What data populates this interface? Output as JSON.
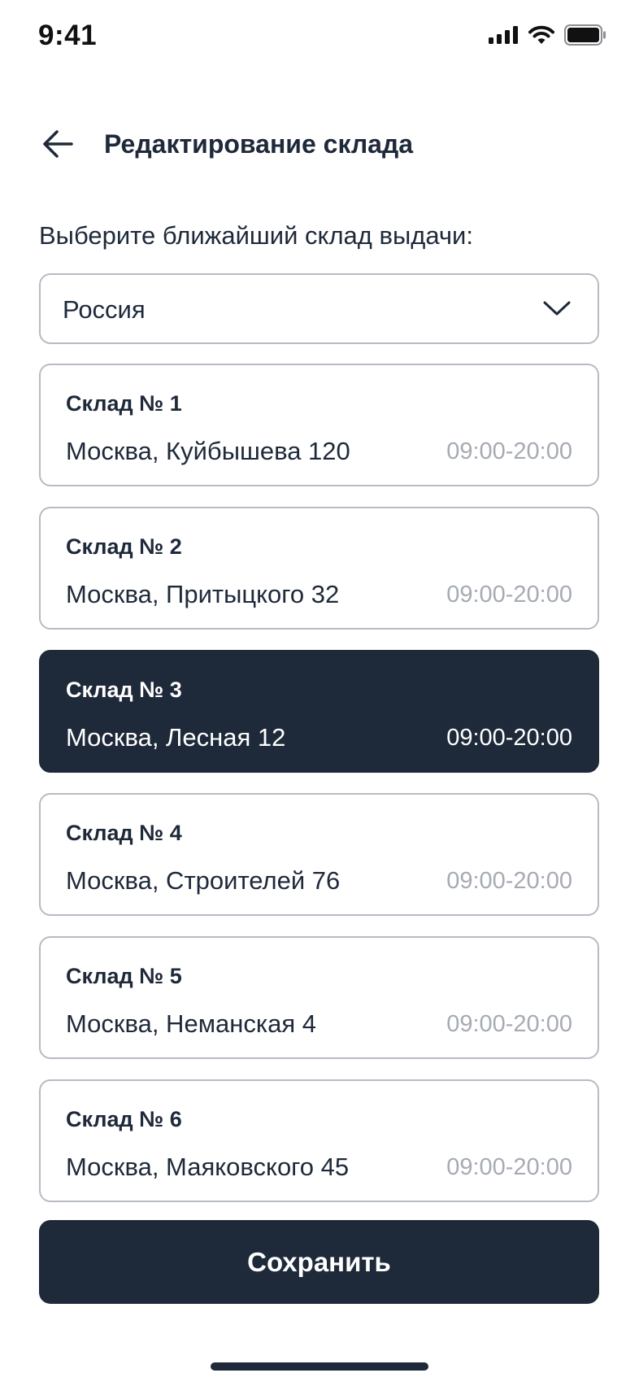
{
  "status_bar": {
    "time": "9:41",
    "icons": [
      "signal-icon",
      "wifi-icon",
      "battery-icon"
    ]
  },
  "header": {
    "back_icon": "arrow-left-icon",
    "title": "Редактирование склада"
  },
  "prompt": "Выберите ближайший склад выдачи:",
  "country_select": {
    "value": "Россия",
    "icon": "chevron-down-icon"
  },
  "warehouses": [
    {
      "title": "Склад № 1",
      "address": "Москва, Куйбышева 120",
      "hours": "09:00-20:00",
      "selected": false
    },
    {
      "title": "Склад № 2",
      "address": "Москва, Притыцкого 32",
      "hours": "09:00-20:00",
      "selected": false
    },
    {
      "title": "Склад № 3",
      "address": "Москва, Лесная 12",
      "hours": "09:00-20:00",
      "selected": true
    },
    {
      "title": "Склад № 4",
      "address": "Москва, Строителей 76",
      "hours": "09:00-20:00",
      "selected": false
    },
    {
      "title": "Склад № 5",
      "address": "Москва, Неманская 4",
      "hours": "09:00-20:00",
      "selected": false
    },
    {
      "title": "Склад № 6",
      "address": "Москва, Маяковского 45",
      "hours": "09:00-20:00",
      "selected": false
    }
  ],
  "save_label": "Сохранить",
  "colors": {
    "primary": "#1e2939",
    "border": "#b6bcc4",
    "muted": "#a6abb3",
    "background": "#ffffff"
  }
}
